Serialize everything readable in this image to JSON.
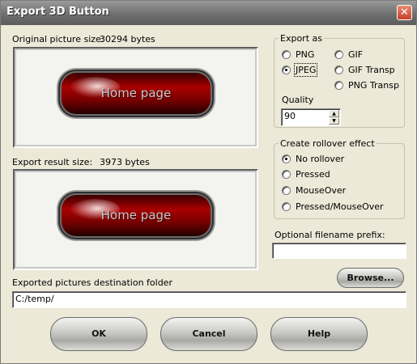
{
  "window": {
    "title": "Export 3D Button",
    "close_glyph": "✕"
  },
  "original": {
    "label": "Original picture size:",
    "size": "30294 bytes",
    "button_text": "Home page"
  },
  "result": {
    "label": "Export result size:",
    "size": "3973 bytes",
    "button_text": "Home page"
  },
  "export_as": {
    "legend": "Export as",
    "options": [
      "PNG",
      "JPEG",
      "GIF",
      "GIF Transp",
      "PNG Transp"
    ],
    "selected": "JPEG",
    "quality_label": "Quality",
    "quality_value": "90"
  },
  "rollover": {
    "legend": "Create rollover effect",
    "options": [
      "No rollover",
      "Pressed",
      "MouseOver",
      "Pressed/MouseOver"
    ],
    "selected": "No rollover"
  },
  "prefix": {
    "label": "Optional filename prefix:",
    "value": ""
  },
  "browse_label": "Browse...",
  "destination": {
    "label": "Exported pictures destination folder",
    "value": "C:/temp/"
  },
  "buttons": {
    "ok": "OK",
    "cancel": "Cancel",
    "help": "Help"
  },
  "icons": {
    "close": "close-icon",
    "spin_up": "spin-up-icon",
    "spin_down": "spin-down-icon"
  }
}
